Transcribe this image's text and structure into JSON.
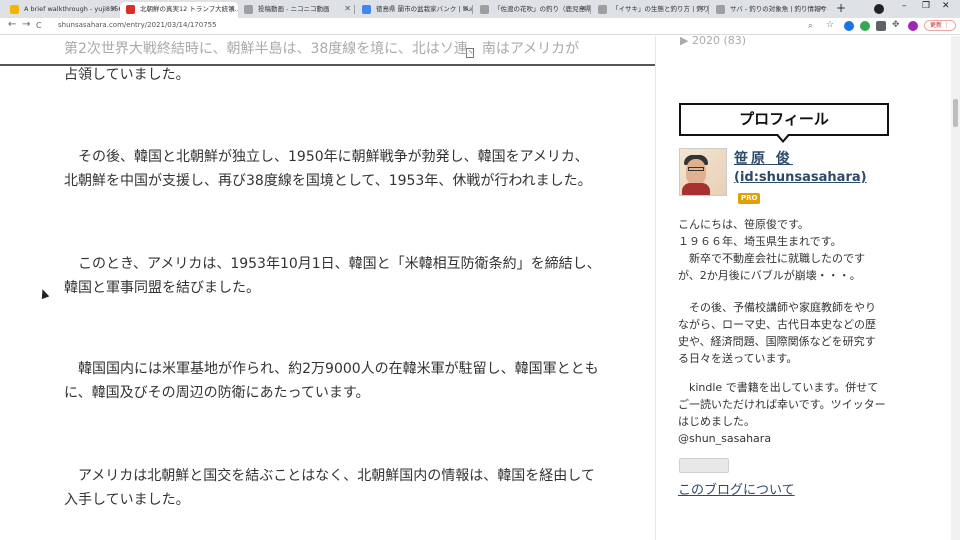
{
  "browser": {
    "tabs": [
      {
        "label": "A brief walkthrough - yuji8556...",
        "color": "#f4b400"
      },
      {
        "label": "北朝鮮の真実12 トランプ大統領...",
        "color": "#d93025",
        "active": true
      },
      {
        "label": "投稿動画 - ニコニコ動画",
        "color": "#9e9e9e"
      },
      {
        "label": "徳島県 蘭市の盆栽家バンク | Sum...",
        "color": "#4285f4"
      },
      {
        "label": "「佐渡の花吹」の釣り（鹿児島県...",
        "color": "#9e9e9e"
      },
      {
        "label": "「イサキ」の生態と釣り方 | 釣り情報...",
        "color": "#9e9e9e"
      },
      {
        "label": "サバ - 釣りの対象魚 | 釣り情報サイ...",
        "color": "#9e9e9e"
      }
    ],
    "new_tab": "+",
    "url": "shunsasahara.com/entry/2021/03/14/170755",
    "update_label": "更新 ⋮",
    "win_min": "–",
    "win_max": "❐",
    "win_close": "✕",
    "back": "←",
    "forward": "→",
    "reload": "C"
  },
  "article": {
    "paragraphs": [
      {
        "lines": [
          "第2次世界大戦終結時に、朝鮮半島は、38度線を境に、北はソ連、南はアメリカが",
          "占領していました。"
        ]
      },
      {
        "lines": [
          "　その後、韓国と北朝鮮が独立し、1950年に朝鮮戦争が勃発し、韓国をアメリカ、",
          "北朝鮮を中国が支援し、再び38度線を国境として、1953年、休戦が行われました。"
        ]
      },
      {
        "lines": [
          "　このとき、アメリカは、1953年10月1日、韓国と「米韓相互防衛条約」を締結し、",
          "韓国と軍事同盟を結びました。"
        ]
      },
      {
        "lines": [
          "　韓国国内には米軍基地が作られ、約2万9000人の在韓米軍が駐留し、韓国軍ととも",
          "に、韓国及びその周辺の防衛にあたっています。"
        ]
      },
      {
        "lines": [
          "　アメリカは北朝鮮と国交を結ぶことはなく、北朝鮮国内の情報は、韓国を経由して",
          "入手していました。"
        ]
      }
    ]
  },
  "sidebar": {
    "archive": "▶ 2020 (83)",
    "profile_heading": "プロフィール",
    "name": "笹原 俊",
    "id": "(id:shunsasahara)",
    "pro_badge": "PRO",
    "bio_lines": [
      "こんにちは、笹原俊です。",
      "１９６６年、埼玉県生まれです。",
      "　新卒で不動産会社に就職したのです",
      "が、2か月後にバブルが崩壊・・・。",
      "",
      "　その後、予備校講師や家庭教師をやり",
      "ながら、ローマ史、古代日本史などの歴",
      "史や、経済問題、国際関係などを研究す",
      "る日々を送っています。",
      "",
      "　kindle で書籍を出しています。併せて",
      "ご一読いただければ幸いです。ツイッター",
      "はじめました。",
      "@shun_sasahara"
    ],
    "about_link": "このブログについて"
  }
}
